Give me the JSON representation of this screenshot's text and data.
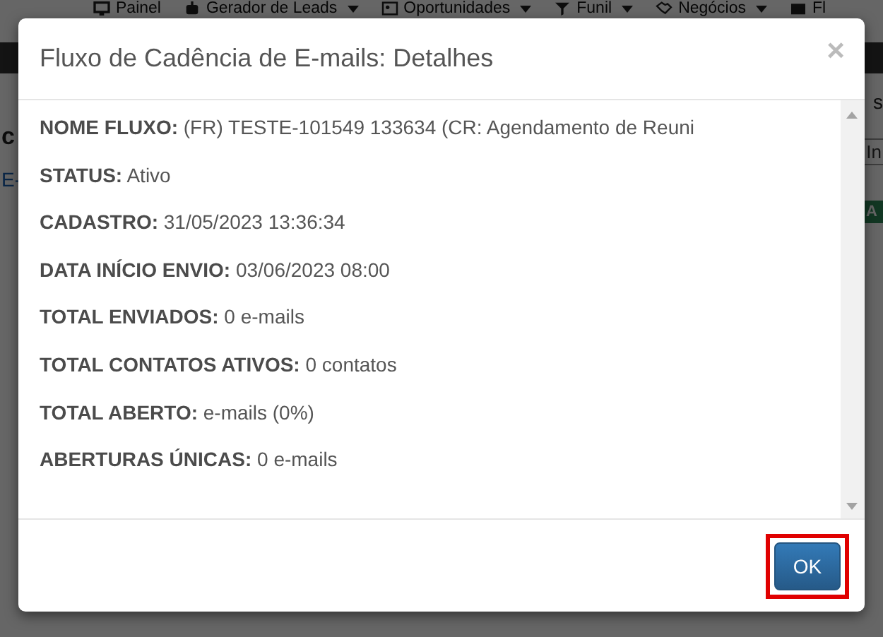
{
  "nav": [
    {
      "label": "Painel",
      "caret": false
    },
    {
      "label": "Gerador de Leads",
      "caret": true
    },
    {
      "label": "Oportunidades",
      "caret": true
    },
    {
      "label": "Funil",
      "caret": true
    },
    {
      "label": "Negócios",
      "caret": true
    },
    {
      "label": "Fl",
      "caret": false
    }
  ],
  "background": {
    "left": [
      {
        "text": "c",
        "kind": "heading"
      },
      {
        "text": "E-",
        "kind": "link"
      }
    ],
    "right": [
      {
        "text": "s",
        "kind": "plain"
      },
      {
        "text": "In",
        "kind": "field"
      },
      {
        "text": "A",
        "kind": "badge"
      }
    ]
  },
  "dialog": {
    "title": "Fluxo de Cadência de E-mails: Detalhes",
    "close": "×",
    "fields": [
      {
        "label": "NOME FLUXO:",
        "value": "(FR) TESTE-101549 133634 (CR: Agendamento de Reuni"
      },
      {
        "label": "STATUS:",
        "value": "Ativo"
      },
      {
        "label": "CADASTRO:",
        "value": "31/05/2023 13:36:34"
      },
      {
        "label": "DATA INÍCIO ENVIO:",
        "value": "03/06/2023 08:00"
      },
      {
        "label": "TOTAL ENVIADOS:",
        "value": "0 e-mails"
      },
      {
        "label": "TOTAL CONTATOS ATIVOS:",
        "value": "0 contatos"
      },
      {
        "label": "TOTAL ABERTO:",
        "value": "e-mails (0%)"
      },
      {
        "label": "ABERTURAS ÚNICAS:",
        "value": "0 e-mails"
      }
    ],
    "button": {
      "label": "OK",
      "highlighted": true
    }
  }
}
